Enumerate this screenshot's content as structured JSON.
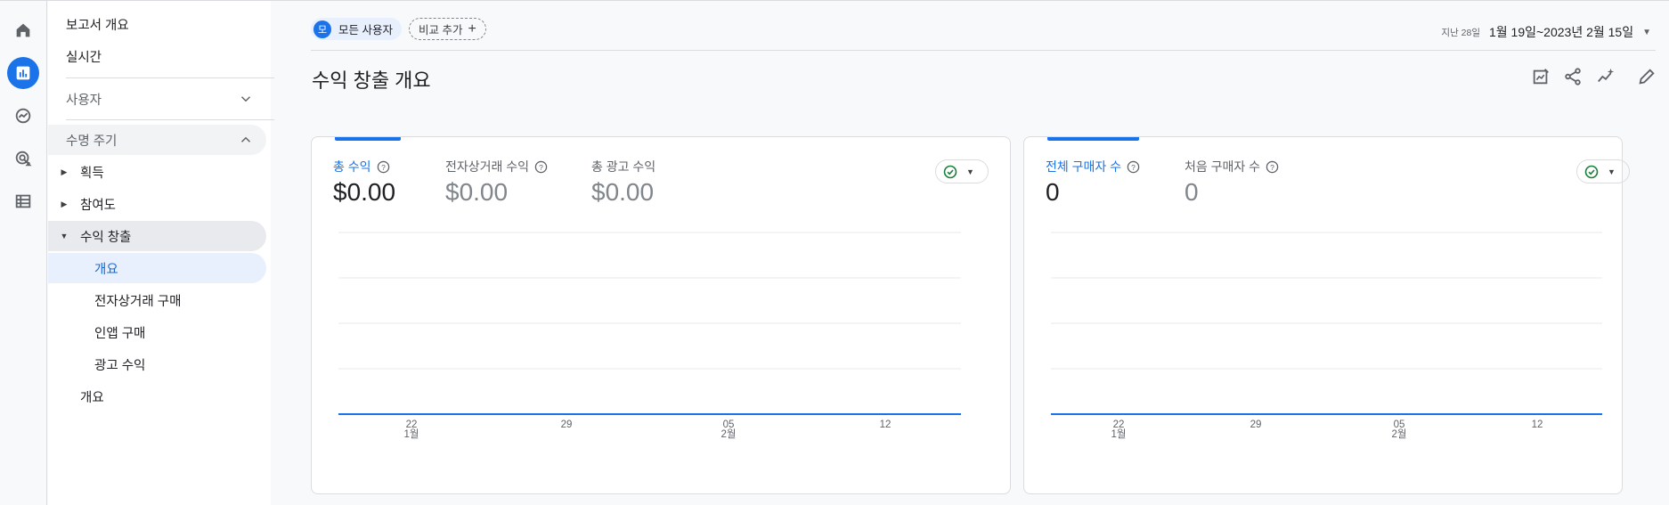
{
  "sidebar": {
    "report_overview": "보고서 개요",
    "realtime": "실시간",
    "section_user": "사용자",
    "section_lifecycle": "수명 주기",
    "items": [
      {
        "label": "획득"
      },
      {
        "label": "참여도"
      },
      {
        "label": "수익 창출"
      }
    ],
    "subitems": [
      {
        "label": "개요"
      },
      {
        "label": "전자상거래 구매"
      },
      {
        "label": "인앱 구매"
      },
      {
        "label": "광고 수익"
      }
    ],
    "bottom_item": "개요"
  },
  "header": {
    "segment_avatar": "모",
    "segment_label": "모든 사용자",
    "add_comparison": "비교 추가",
    "date_prefix": "지난 28일",
    "date_range": "1월 19일~2023년 2월 15일",
    "page_title": "수익 창출 개요"
  },
  "cards": [
    {
      "metrics": [
        {
          "label": "총 수익",
          "value": "$0.00",
          "active": true,
          "help": true
        },
        {
          "label": "전자상거래 수익",
          "value": "$0.00",
          "active": false,
          "help": true
        },
        {
          "label": "총 광고 수익",
          "value": "$0.00",
          "active": false,
          "help": false
        }
      ]
    },
    {
      "metrics": [
        {
          "label": "전체 구매자 수",
          "value": "0",
          "active": true,
          "help": true
        },
        {
          "label": "처음 구매자 수",
          "value": "0",
          "active": false,
          "help": true
        }
      ]
    }
  ],
  "chart_data": [
    {
      "type": "line",
      "title": "",
      "x": [
        "1월 19일",
        "1월 22일",
        "1월 29일",
        "2월 5일",
        "2월 12일",
        "2월 15일"
      ],
      "x_tick_labels": [
        [
          "22",
          "1월"
        ],
        [
          "29",
          ""
        ],
        [
          "05",
          "2월"
        ],
        [
          "12",
          ""
        ]
      ],
      "series": [
        {
          "values": [
            0,
            0,
            0,
            0,
            0,
            0
          ]
        }
      ],
      "grid": true,
      "color": "#1a73e8"
    },
    {
      "type": "line",
      "title": "",
      "x": [
        "1월 19일",
        "1월 22일",
        "1월 29일",
        "2월 5일",
        "2월 12일",
        "2월 15일"
      ],
      "x_tick_labels": [
        [
          "22",
          "1월"
        ],
        [
          "29",
          ""
        ],
        [
          "05",
          "2월"
        ],
        [
          "12",
          ""
        ]
      ],
      "series": [
        {
          "values": [
            0,
            0,
            0,
            0,
            0,
            0
          ]
        }
      ],
      "grid": true,
      "color": "#1a73e8"
    }
  ],
  "colors": {
    "accent": "#1a73e8",
    "status_ok": "#188038"
  },
  "icons": {
    "rail": [
      "home-icon",
      "reports-icon",
      "explore-icon",
      "advertising-icon",
      "configure-icon"
    ],
    "toolbar": [
      "customize-report-icon",
      "share-icon",
      "insights-icon",
      "edit-icon"
    ]
  }
}
